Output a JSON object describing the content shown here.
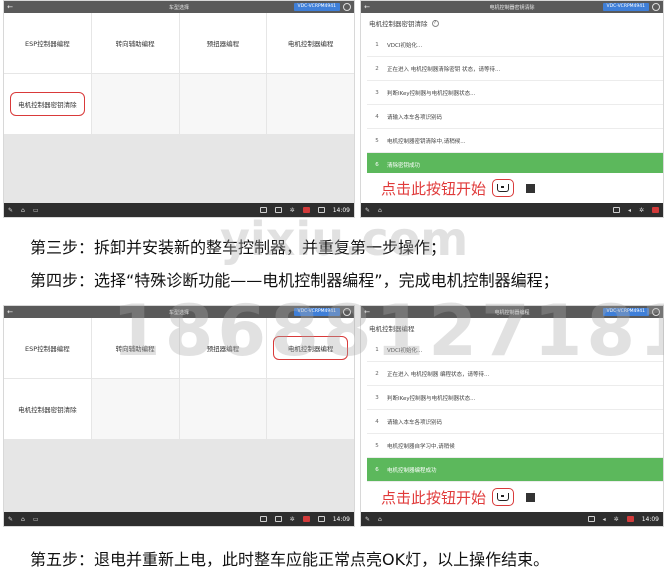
{
  "screens": {
    "top_left": {
      "title": "车型选择",
      "badge": "VDC-VCRPM4941",
      "tiles": [
        "ESP控制器编程",
        "转向辅助编程",
        "预扭器编程",
        "电机控制器编程",
        "电机控制器密钥清除"
      ],
      "time": "14:09"
    },
    "top_right": {
      "title": "电机控制器密钥清除",
      "badge": "VDC-VCRPM4941",
      "heading": "电机控制器密钥清除",
      "steps": [
        {
          "num": "1",
          "text": "VDCI初始化..."
        },
        {
          "num": "2",
          "text": "正在进入 电机控制器清除密钥 状态，请等待..."
        },
        {
          "num": "3",
          "text": "判断IKey控制器与电机控制器状态..."
        },
        {
          "num": "4",
          "text": "请输入本车各项识别码"
        },
        {
          "num": "5",
          "text": "电机控制器密钥清除中,请稍候..."
        },
        {
          "num": "6",
          "text": "清除密钥成功"
        }
      ],
      "action_text": "点击此按钮开始"
    },
    "bottom_left": {
      "title": "车型选择",
      "badge": "VDC-VCRPM4941",
      "tiles": [
        "ESP控制器编程",
        "转向辅助编程",
        "预扭器编程",
        "电机控制器编程",
        "电机控制器密钥清除"
      ],
      "time": "14:09"
    },
    "bottom_right": {
      "title": "电机控制器编程",
      "badge": "VDC-VCRPM4941",
      "heading": "电机控制器编程",
      "steps": [
        {
          "num": "1",
          "text": "VDCI初始化..."
        },
        {
          "num": "2",
          "text": "正在进入 电机控制器 编程状态，请等待..."
        },
        {
          "num": "3",
          "text": "判断IKey控制器与电机控制器状态..."
        },
        {
          "num": "4",
          "text": "请输入本车各项识别码"
        },
        {
          "num": "5",
          "text": "电机控制器自学习中,请稍候"
        },
        {
          "num": "6",
          "text": "电机控制器编程成功"
        }
      ],
      "action_text": "点击此按钮开始",
      "time": "14:09"
    }
  },
  "text": {
    "step3": "第三步：拆卸并安装新的整车控制器，并重复第一步操作；",
    "step4": "第四步：选择“特殊诊断功能——电机控制器编程”，完成电机控制器编程；",
    "step5": "第五步：退电并重新上电，此时整车应能正常点亮OK灯，以上操作结束。"
  },
  "watermark": {
    "line1": "yixiu.com",
    "line2": "18688127181"
  }
}
